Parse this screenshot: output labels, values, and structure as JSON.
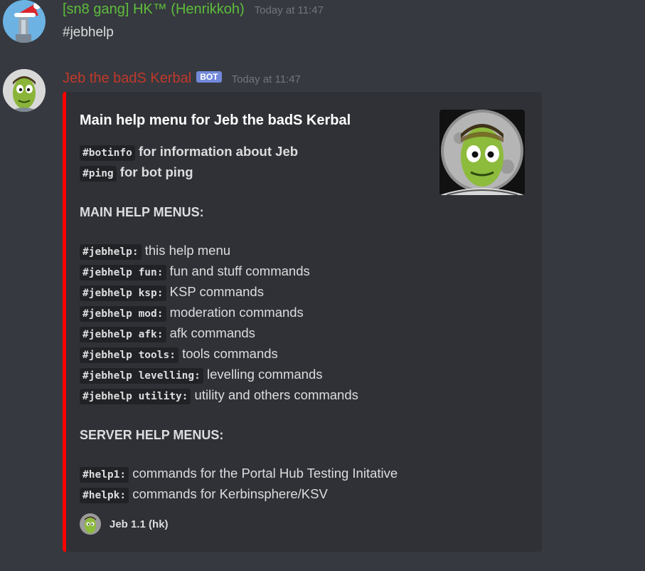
{
  "messages": [
    {
      "username": "[sn8 gang] HK™ (Henrikkoh)",
      "username_color": "#5ebd3c",
      "timestamp": "Today at 11:47",
      "content": "#jebhelp"
    },
    {
      "username": "Jeb the badS Kerbal",
      "username_color": "#c0392b",
      "bot_tag": "BOT",
      "timestamp": "Today at 11:47"
    }
  ],
  "embed": {
    "color": "#ff0000",
    "title": "Main help menu for Jeb the badS Kerbal",
    "intro": [
      {
        "code": "#botinfo",
        "text": "for information about Jeb"
      },
      {
        "code": "#ping",
        "text": "for bot ping"
      }
    ],
    "main_heading": "MAIN HELP MENUS:",
    "main_items": [
      {
        "code": "#jebhelp:",
        "text": "this help menu"
      },
      {
        "code": "#jebhelp fun:",
        "text": "fun and stuff commands"
      },
      {
        "code": "#jebhelp ksp:",
        "text": "KSP commands"
      },
      {
        "code": "#jebhelp mod:",
        "text": "moderation commands"
      },
      {
        "code": "#jebhelp afk:",
        "text": "afk commands"
      },
      {
        "code": "#jebhelp tools:",
        "text": "tools commands"
      },
      {
        "code": "#jebhelp levelling:",
        "text": "levelling commands"
      },
      {
        "code": "#jebhelp utility:",
        "text": "utility and others commands"
      }
    ],
    "server_heading": "SERVER HELP MENUS:",
    "server_items": [
      {
        "code": "#help1:",
        "text": "commands for the Portal Hub Testing Initative"
      },
      {
        "code": "#helpk:",
        "text": "commands for Kerbinsphere/KSV"
      }
    ],
    "footer": "Jeb 1.1 (hk)"
  },
  "icons": {
    "user_avatar": "santa-hat-rocket-avatar-icon",
    "bot_avatar": "kerbal-face-avatar-icon",
    "embed_thumbnail": "kerbal-thumbnail-icon",
    "footer_icon": "kerbal-footer-icon"
  }
}
